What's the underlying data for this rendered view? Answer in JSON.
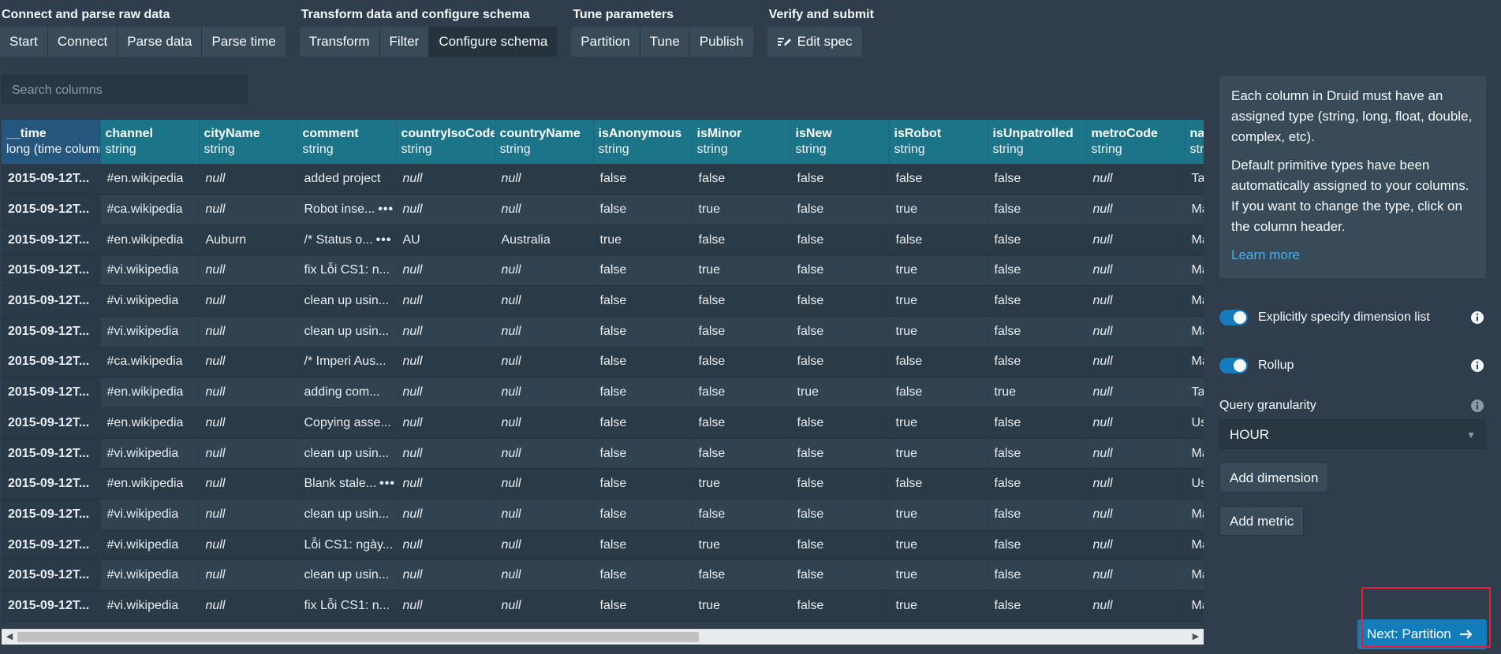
{
  "steps": [
    {
      "title": "Connect and parse raw data",
      "buttons": [
        {
          "label": "Start",
          "active": false
        },
        {
          "label": "Connect",
          "active": false
        },
        {
          "label": "Parse data",
          "active": false
        },
        {
          "label": "Parse time",
          "active": false
        }
      ]
    },
    {
      "title": "Transform data and configure schema",
      "buttons": [
        {
          "label": "Transform",
          "active": false
        },
        {
          "label": "Filter",
          "active": false
        },
        {
          "label": "Configure schema",
          "active": true
        }
      ]
    },
    {
      "title": "Tune parameters",
      "buttons": [
        {
          "label": "Partition",
          "active": false
        },
        {
          "label": "Tune",
          "active": false
        },
        {
          "label": "Publish",
          "active": false
        }
      ]
    },
    {
      "title": "Verify and submit",
      "buttons": [
        {
          "label": "Edit spec",
          "active": false,
          "icon": "edit-spec-icon"
        }
      ]
    }
  ],
  "search": {
    "placeholder": "Search columns"
  },
  "table": {
    "columns": [
      {
        "name": "__time",
        "type": "long (time column)"
      },
      {
        "name": "channel",
        "type": "string"
      },
      {
        "name": "cityName",
        "type": "string"
      },
      {
        "name": "comment",
        "type": "string"
      },
      {
        "name": "countryIsoCode",
        "type": "string"
      },
      {
        "name": "countryName",
        "type": "string"
      },
      {
        "name": "isAnonymous",
        "type": "string"
      },
      {
        "name": "isMinor",
        "type": "string"
      },
      {
        "name": "isNew",
        "type": "string"
      },
      {
        "name": "isRobot",
        "type": "string"
      },
      {
        "name": "isUnpatrolled",
        "type": "string"
      },
      {
        "name": "metroCode",
        "type": "string"
      },
      {
        "name": "namespace",
        "type": "string"
      }
    ],
    "rows": [
      [
        "2015-09-12T...",
        "#en.wikipedia",
        "null",
        "added project",
        "null",
        "null",
        "false",
        "false",
        "false",
        "false",
        "false",
        "null",
        "Talk"
      ],
      [
        "2015-09-12T...",
        "#ca.wikipedia",
        "null",
        "Robot inse...",
        "null",
        "null",
        "false",
        "true",
        "false",
        "true",
        "false",
        "null",
        "Main"
      ],
      [
        "2015-09-12T...",
        "#en.wikipedia",
        "Auburn",
        "/* Status o...",
        "AU",
        "Australia",
        "true",
        "false",
        "false",
        "false",
        "false",
        "null",
        "Main"
      ],
      [
        "2015-09-12T...",
        "#vi.wikipedia",
        "null",
        "fix Lỗi CS1: n...",
        "null",
        "null",
        "false",
        "true",
        "false",
        "true",
        "false",
        "null",
        "Main"
      ],
      [
        "2015-09-12T...",
        "#vi.wikipedia",
        "null",
        "clean up usin...",
        "null",
        "null",
        "false",
        "false",
        "false",
        "true",
        "false",
        "null",
        "Main"
      ],
      [
        "2015-09-12T...",
        "#vi.wikipedia",
        "null",
        "clean up usin...",
        "null",
        "null",
        "false",
        "false",
        "false",
        "true",
        "false",
        "null",
        "Main"
      ],
      [
        "2015-09-12T...",
        "#ca.wikipedia",
        "null",
        "/* Imperi Aus...",
        "null",
        "null",
        "false",
        "false",
        "false",
        "false",
        "false",
        "null",
        "Main"
      ],
      [
        "2015-09-12T...",
        "#en.wikipedia",
        "null",
        "adding com...",
        "null",
        "null",
        "false",
        "false",
        "true",
        "false",
        "true",
        "null",
        "Talk"
      ],
      [
        "2015-09-12T...",
        "#en.wikipedia",
        "null",
        "Copying asse...",
        "null",
        "null",
        "false",
        "false",
        "false",
        "true",
        "false",
        "null",
        "User"
      ],
      [
        "2015-09-12T...",
        "#vi.wikipedia",
        "null",
        "clean up usin...",
        "null",
        "null",
        "false",
        "false",
        "false",
        "true",
        "false",
        "null",
        "Main"
      ],
      [
        "2015-09-12T...",
        "#en.wikipedia",
        "null",
        "Blank stale...",
        "null",
        "null",
        "false",
        "true",
        "false",
        "false",
        "false",
        "null",
        "User"
      ],
      [
        "2015-09-12T...",
        "#vi.wikipedia",
        "null",
        "clean up usin...",
        "null",
        "null",
        "false",
        "false",
        "false",
        "true",
        "false",
        "null",
        "Main"
      ],
      [
        "2015-09-12T...",
        "#vi.wikipedia",
        "null",
        "Lỗi CS1: ngày...",
        "null",
        "null",
        "false",
        "true",
        "false",
        "true",
        "false",
        "null",
        "Main"
      ],
      [
        "2015-09-12T...",
        "#vi.wikipedia",
        "null",
        "clean up usin...",
        "null",
        "null",
        "false",
        "false",
        "false",
        "true",
        "false",
        "null",
        "Main"
      ],
      [
        "2015-09-12T...",
        "#vi.wikipedia",
        "null",
        "fix Lỗi CS1: n...",
        "null",
        "null",
        "false",
        "true",
        "false",
        "true",
        "false",
        "null",
        "Main"
      ]
    ],
    "expandable_rows": [
      1,
      2,
      10
    ]
  },
  "panel": {
    "info_p1": "Each column in Druid must have an assigned type (string, long, float, double, complex, etc).",
    "info_p2": "Default primitive types have been automatically assigned to your columns. If you want to change the type, click on the column header.",
    "learn_more": "Learn more",
    "dimension_switch_label": "Explicitly specify dimension list",
    "dimension_switch_on": true,
    "rollup_label": "Rollup",
    "rollup_on": true,
    "granularity_label": "Query granularity",
    "granularity_value": "HOUR",
    "add_dimension": "Add dimension",
    "add_metric": "Add metric"
  },
  "next_button": {
    "label": "Next: Partition"
  },
  "colors": {
    "accent": "#137cbd",
    "header_teal": "#1c7488",
    "highlight": "#e0202a"
  }
}
